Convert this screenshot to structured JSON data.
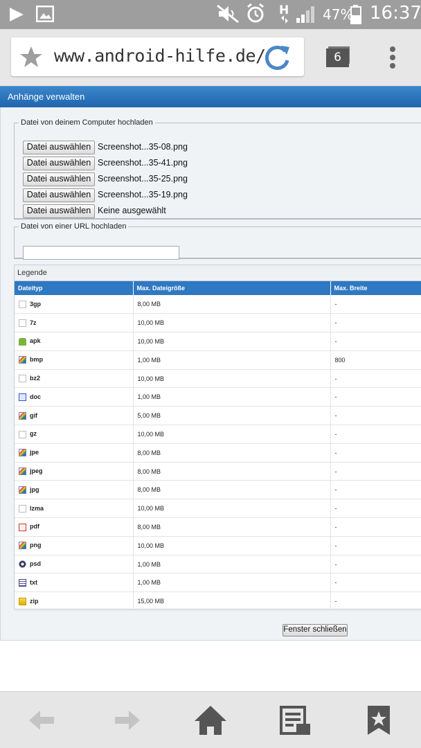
{
  "status_bar": {
    "battery_percent": "47%",
    "clock": "16:37",
    "icons": [
      "play-icon",
      "image-icon",
      "mute-icon",
      "alarm-icon",
      "hsdpa-icon",
      "signal-icon",
      "battery-icon"
    ]
  },
  "browser": {
    "url": "www.android-hilfe.de/",
    "tab_count": "6"
  },
  "page": {
    "title": "Anhänge verwalten",
    "upload_computer": {
      "legend": "Datei von deinem Computer hochladen",
      "button_label": "Datei auswählen",
      "files": [
        "Screenshot...35-08.png",
        "Screenshot...35-41.png",
        "Screenshot...35-25.png",
        "Screenshot...35-19.png",
        "Keine ausgewählt"
      ]
    },
    "upload_url": {
      "legend": "Datei von einer URL hochladen",
      "value": ""
    },
    "legend_section": {
      "title": "Legende",
      "columns": [
        "Dateityp",
        "Max. Dateigröße",
        "Max. Breite"
      ],
      "rows": [
        {
          "type": "3gp",
          "icon": "generic",
          "size": "8,00 MB",
          "width": "-"
        },
        {
          "type": "7z",
          "icon": "generic",
          "size": "10,00 MB",
          "width": "-"
        },
        {
          "type": "apk",
          "icon": "apk",
          "size": "10,00 MB",
          "width": "-"
        },
        {
          "type": "bmp",
          "icon": "img",
          "size": "1,00 MB",
          "width": "800"
        },
        {
          "type": "bz2",
          "icon": "generic",
          "size": "10,00 MB",
          "width": "-"
        },
        {
          "type": "doc",
          "icon": "doc",
          "size": "1,00 MB",
          "width": "-"
        },
        {
          "type": "gif",
          "icon": "img",
          "size": "5,00 MB",
          "width": "-"
        },
        {
          "type": "gz",
          "icon": "generic",
          "size": "10,00 MB",
          "width": "-"
        },
        {
          "type": "jpe",
          "icon": "img",
          "size": "8,00 MB",
          "width": "-"
        },
        {
          "type": "jpeg",
          "icon": "img",
          "size": "8,00 MB",
          "width": "-"
        },
        {
          "type": "jpg",
          "icon": "img",
          "size": "8,00 MB",
          "width": "-"
        },
        {
          "type": "lzma",
          "icon": "generic",
          "size": "10,00 MB",
          "width": "-"
        },
        {
          "type": "pdf",
          "icon": "pdf",
          "size": "8,00 MB",
          "width": "-"
        },
        {
          "type": "png",
          "icon": "img",
          "size": "10,00 MB",
          "width": "-"
        },
        {
          "type": "psd",
          "icon": "psd",
          "size": "1,00 MB",
          "width": "-"
        },
        {
          "type": "txt",
          "icon": "txt",
          "size": "1,00 MB",
          "width": "-"
        },
        {
          "type": "zip",
          "icon": "zip",
          "size": "15,00 MB",
          "width": "-"
        }
      ]
    },
    "close_button": "Fenster schließen"
  },
  "bottom_nav": [
    "back-icon",
    "forward-icon",
    "home-icon",
    "reader-icon",
    "bookmarks-icon"
  ],
  "colors": {
    "header_blue": "#1f65ad",
    "table_header_blue": "#2f78c2",
    "statusbar": "#9e9e9e",
    "refresh_blue": "#4a87c5"
  }
}
